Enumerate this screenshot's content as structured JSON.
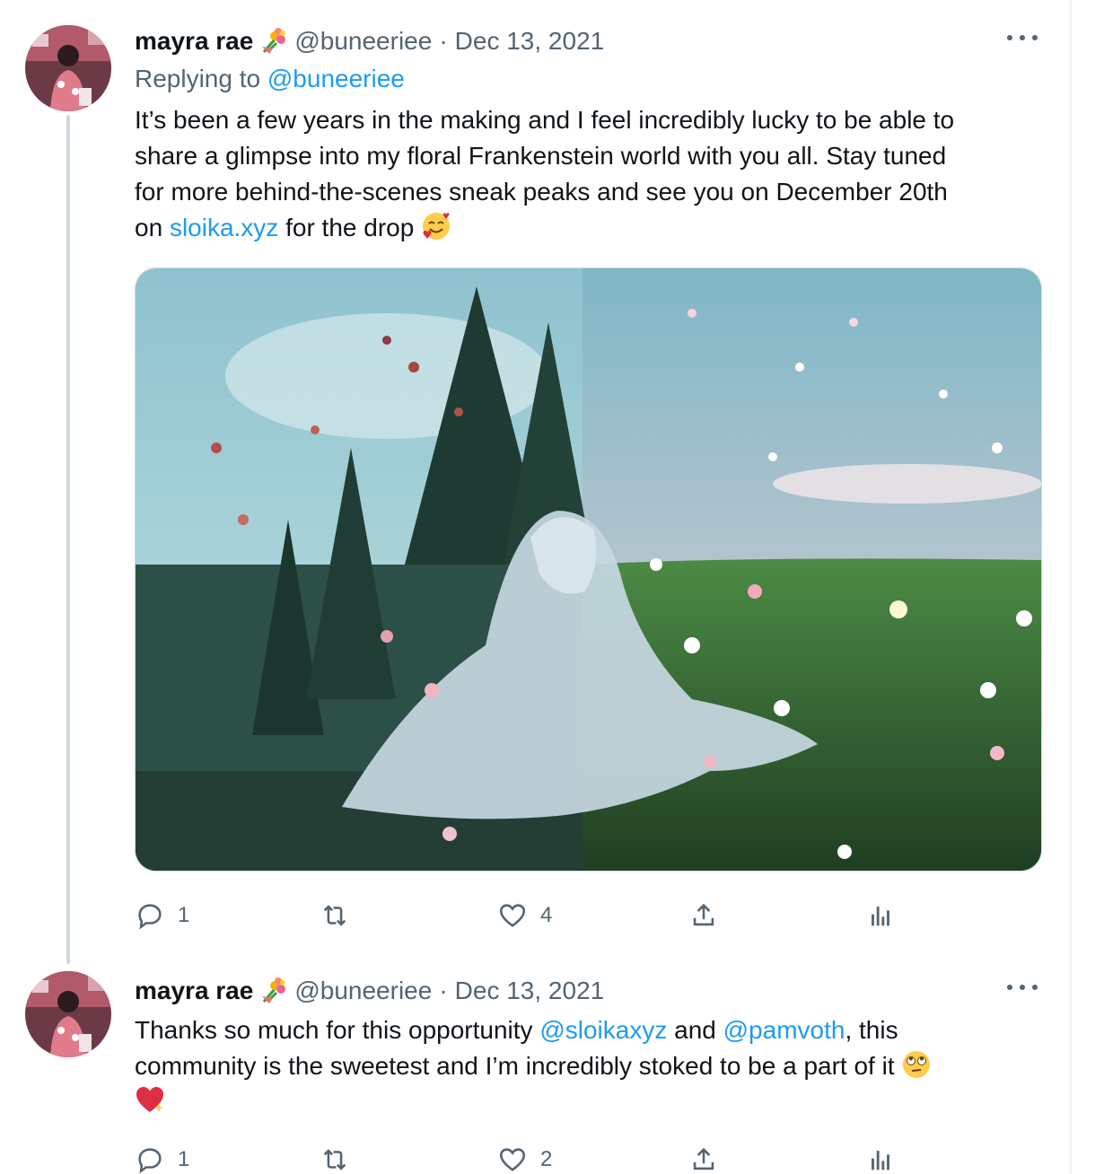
{
  "colors": {
    "link": "#1d9bf0",
    "muted": "#536471",
    "text": "#0f1419",
    "thread_line": "#cfd9de"
  },
  "tweets": [
    {
      "name": "mayra rae",
      "name_emoji": "bouquet-icon",
      "handle": "@buneeriee",
      "separator": "·",
      "date": "Dec 13, 2021",
      "replying_prefix": "Replying to",
      "replying_to": "@buneeriee",
      "text_lines": [
        "It’s been a few years in the making and I feel incredibly lucky to be able to",
        "share a glimpse into my floral Frankenstein world with you all. Stay tuned",
        "for more behind-the-scenes sneak peaks and see you on December 20th"
      ],
      "last_line_prefix": "on",
      "link_text": "sloika.xyz",
      "last_line_suffix": "for the drop",
      "trailing_emoji": "smiling-face-with-hearts-icon",
      "media_alt": "woman-in-white-dress-with-flowers-icon",
      "counts": {
        "reply": "1",
        "retweet": "",
        "like": "4"
      }
    },
    {
      "name": "mayra rae",
      "name_emoji": "bouquet-icon",
      "handle": "@buneeriee",
      "separator": "·",
      "date": "Dec 13, 2021",
      "line1_prefix": "Thanks so much for this opportunity",
      "mention1": "@sloikaxyz",
      "line1_and": "and",
      "mention2": "@pamvoth",
      "line1_suffix": ", this",
      "line2": "community is the sweetest and I’m incredibly stoked to be a part of it",
      "emoji1": "face-with-rolling-eyes-icon",
      "emoji2": "sparkling-heart-icon",
      "counts": {
        "reply": "1",
        "retweet": "",
        "like": "2"
      }
    }
  ]
}
